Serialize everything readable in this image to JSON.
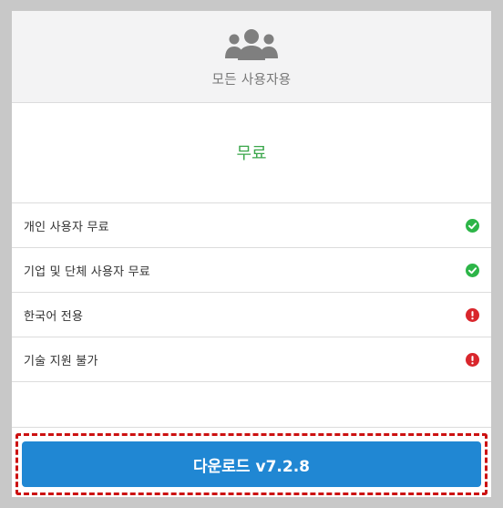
{
  "header": {
    "icon": "users-group-icon",
    "title": "모든 사용자용"
  },
  "price": {
    "label": "무료",
    "color": "#3aa64a"
  },
  "features": [
    {
      "label": "개인 사용자 무료",
      "status": "check",
      "icon": "check-circle-icon",
      "color": "#2db548"
    },
    {
      "label": "기업 및 단체 사용자 무료",
      "status": "check",
      "icon": "check-circle-icon",
      "color": "#2db548"
    },
    {
      "label": "한국어 전용",
      "status": "warning",
      "icon": "exclamation-circle-icon",
      "color": "#d9262c"
    },
    {
      "label": "기술 지원 불가",
      "status": "warning",
      "icon": "exclamation-circle-icon",
      "color": "#d9262c"
    }
  ],
  "download": {
    "label": "다운로드 v7.2.8",
    "color": "#2087d3",
    "highlight_color": "#cc1111"
  }
}
